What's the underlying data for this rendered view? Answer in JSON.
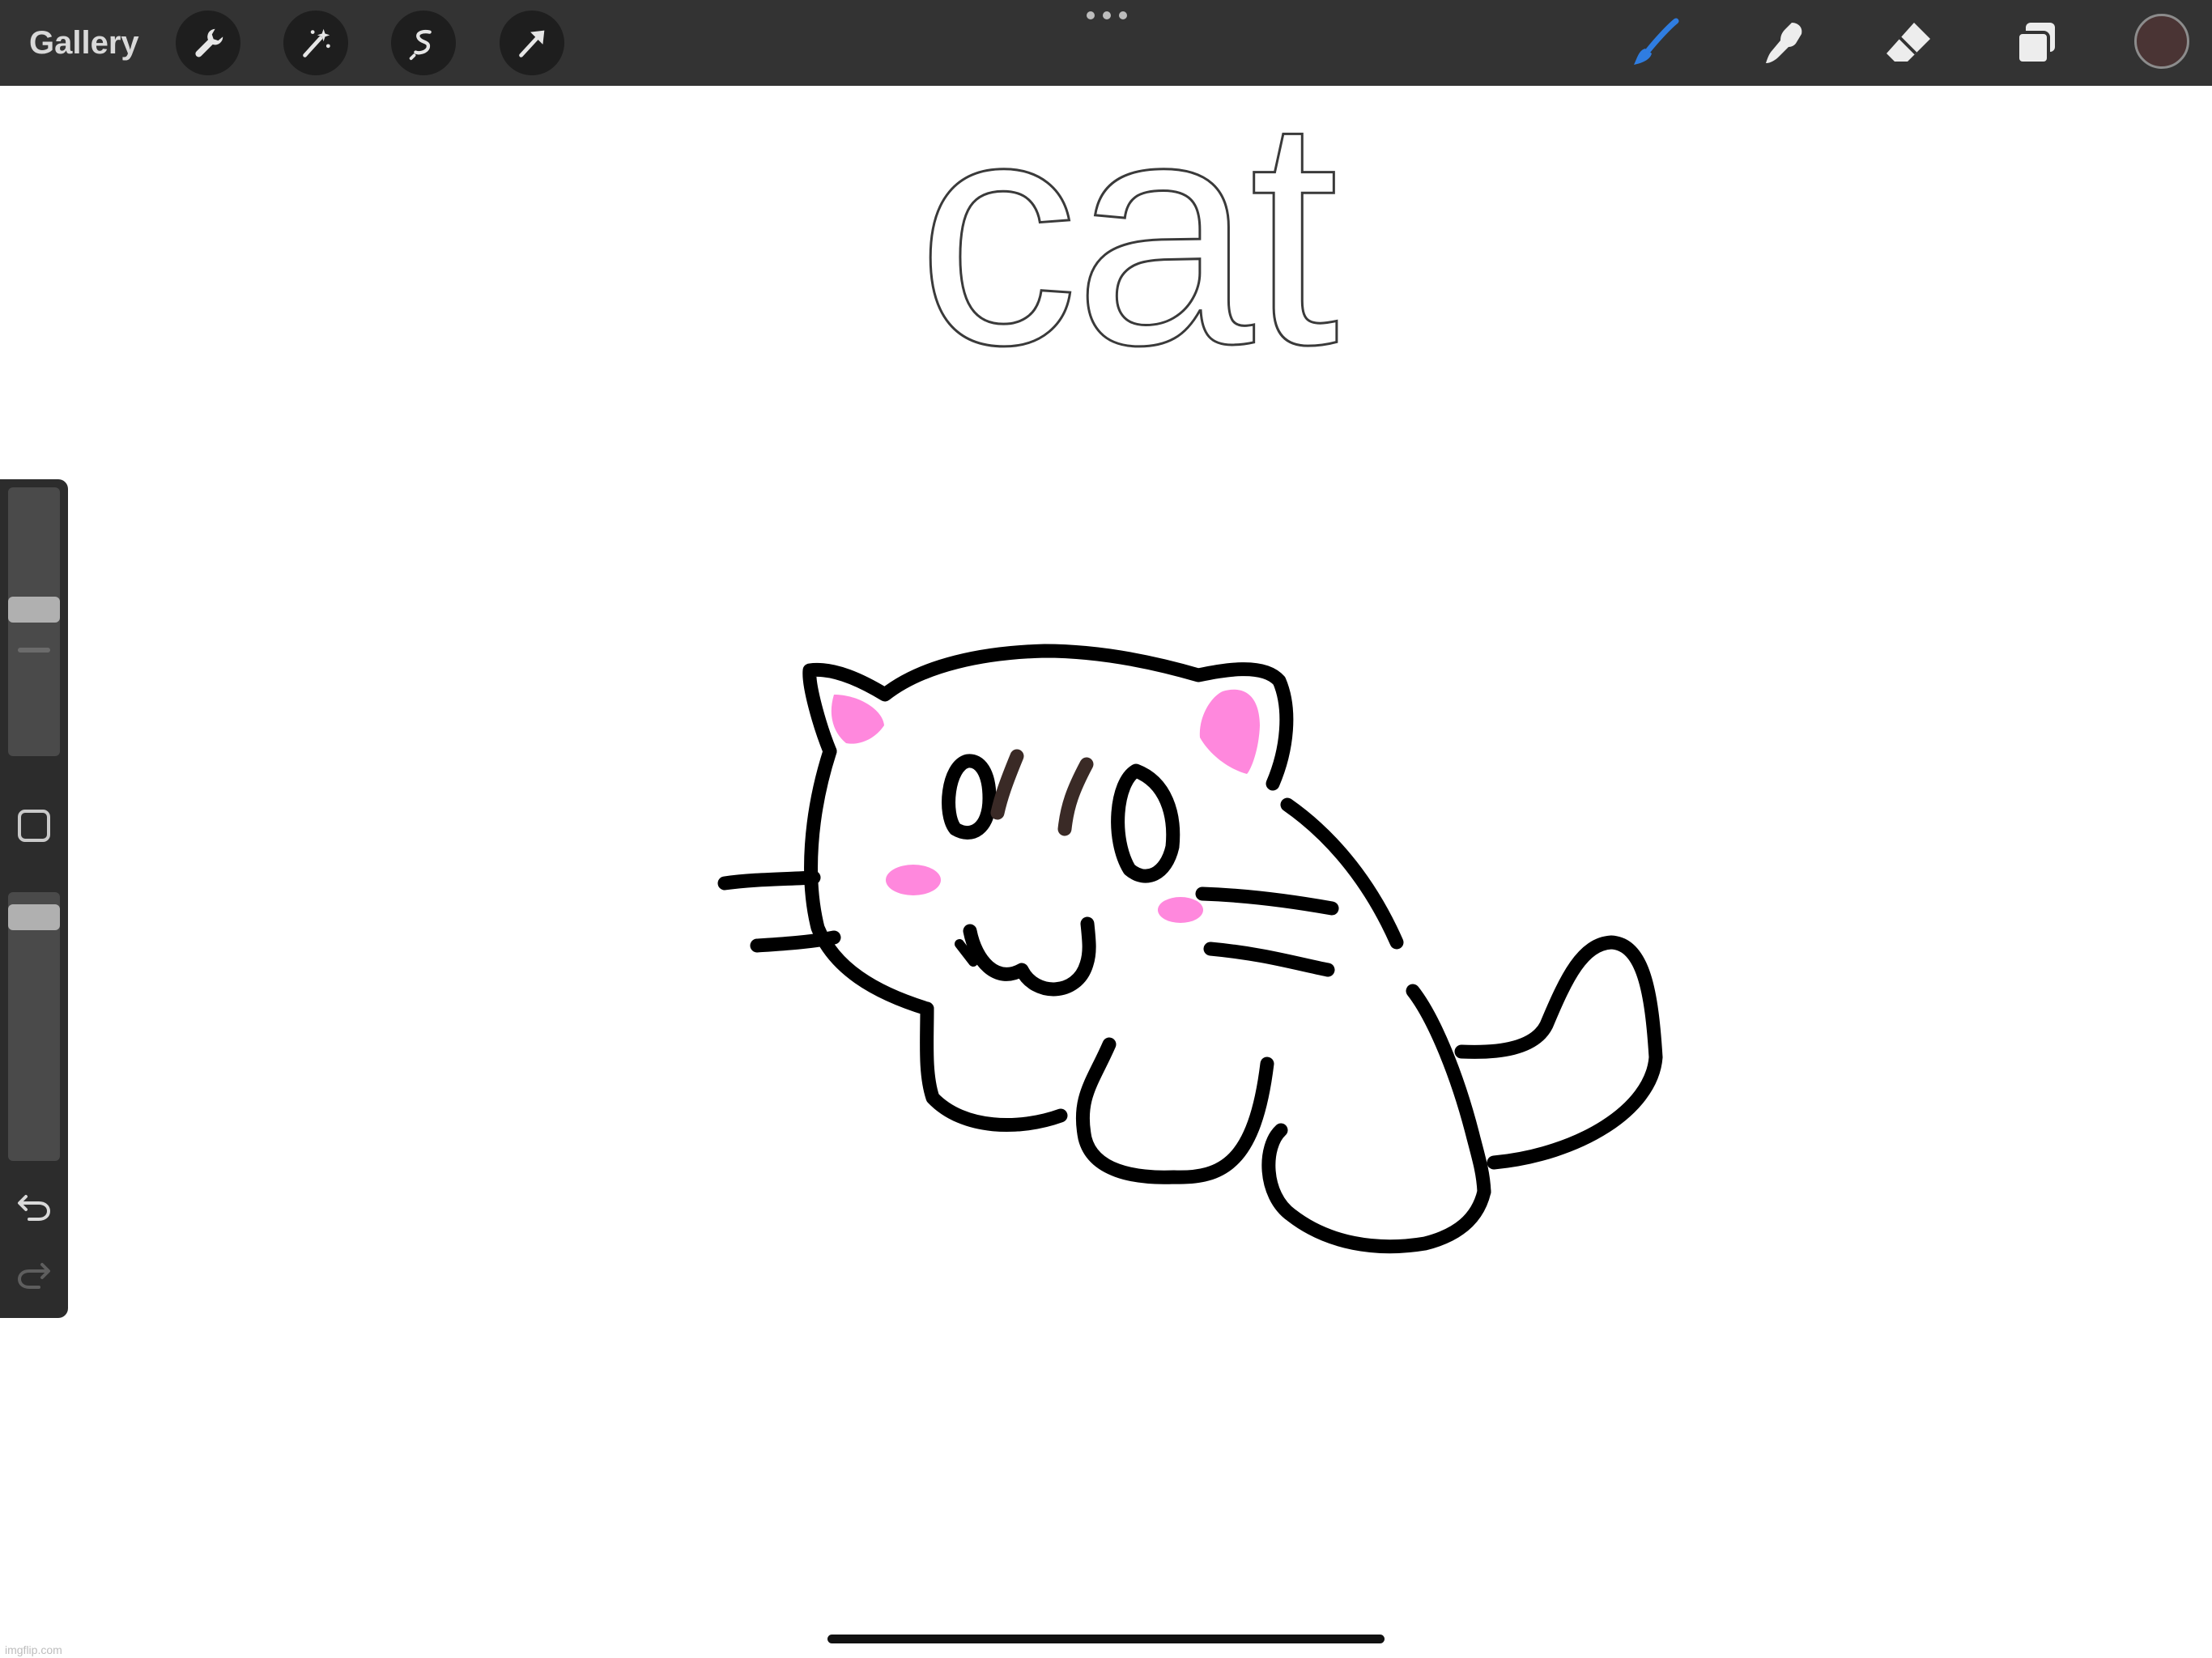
{
  "app": "Procreate",
  "toolbar": {
    "gallery_label": "Gallery",
    "left_tools": [
      "wrench-icon",
      "magic-wand-icon",
      "selection-icon",
      "transform-arrow-icon"
    ],
    "right_tools": [
      "brush-icon",
      "smudge-icon",
      "eraser-icon",
      "layers-icon"
    ],
    "active_tool": "brush",
    "active_tool_color": "#2f7de1",
    "current_color": "#4a3434"
  },
  "canvas": {
    "title_text": "cat",
    "drawing": "cat-doodle",
    "stroke_color": "#000000",
    "blush_color": "#ff88dd",
    "stripe_color": "#3a2a26"
  },
  "sidebar": {
    "brush_size_level": 0.55,
    "opacity_level": 0.95,
    "modify_button": "square-modify-icon",
    "undo": "undo-icon",
    "redo": "redo-icon"
  },
  "watermark": "imgflip.com"
}
